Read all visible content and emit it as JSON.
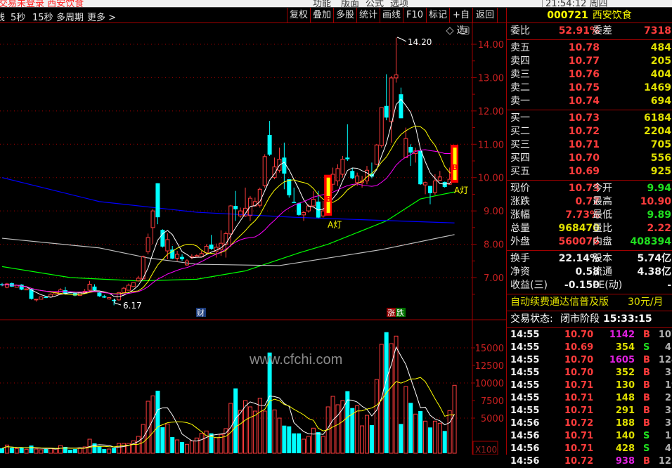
{
  "window": {
    "title": "交易未登录 西安饮食",
    "menu": [
      "功能",
      "版面",
      "公式",
      "选项"
    ],
    "clock": "21:54:12 周四"
  },
  "toolbar": {
    "left": [
      "线",
      "5秒",
      "15秒",
      "多周期",
      "更多 >"
    ],
    "buttons": [
      "复权",
      "叠加",
      "多股",
      "统计",
      "画线",
      "F10",
      "标记",
      "+自选",
      "返回"
    ]
  },
  "stock": {
    "code": "000721",
    "name": "西安饮食"
  },
  "order_ratio": {
    "label1": "委比",
    "value1": "52.91%",
    "label2": "委差",
    "value2": "7318"
  },
  "sell": [
    {
      "label": "卖五",
      "price": "10.78",
      "vol": "484"
    },
    {
      "label": "卖四",
      "price": "10.77",
      "vol": "205"
    },
    {
      "label": "卖三",
      "price": "10.76",
      "vol": "404"
    },
    {
      "label": "卖二",
      "price": "10.75",
      "vol": "1469"
    },
    {
      "label": "卖一",
      "price": "10.74",
      "vol": "694"
    }
  ],
  "buy": [
    {
      "label": "买一",
      "price": "10.73",
      "vol": "6184"
    },
    {
      "label": "买二",
      "price": "10.72",
      "vol": "2204"
    },
    {
      "label": "买三",
      "price": "10.71",
      "vol": "705"
    },
    {
      "label": "买四",
      "price": "10.70",
      "vol": "556"
    },
    {
      "label": "买五",
      "price": "10.69",
      "vol": "925"
    }
  ],
  "quote": [
    {
      "l1": "现价",
      "v1": "10.73",
      "c1": "red",
      "l2": "今开",
      "v2": "9.94",
      "c2": "grn"
    },
    {
      "l1": "涨跌",
      "v1": "0.77",
      "c1": "red",
      "l2": "最高",
      "v2": "10.90",
      "c2": "red"
    },
    {
      "l1": "涨幅",
      "v1": "7.73%",
      "c1": "red",
      "l2": "最低",
      "v2": "9.89",
      "c2": "grn"
    },
    {
      "l1": "总量",
      "v1": "968470",
      "c1": "yel",
      "l2": "量比",
      "v2": "2.22",
      "c2": "red"
    },
    {
      "l1": "外盘",
      "v1": "560076",
      "c1": "red",
      "l2": "内盘",
      "v2": "408394",
      "c2": "grn"
    }
  ],
  "finance": [
    {
      "l1": "换手",
      "v1": "22.14%",
      "l2": "股本",
      "v2": "5.74亿"
    },
    {
      "l1": "净资",
      "v1": "0.58",
      "l2": "流通",
      "v2": "4.38亿"
    },
    {
      "l1": "收益(三)",
      "v1": "-0.150",
      "l2": "PE(动)",
      "v2": "-"
    }
  ],
  "promo": {
    "text": "自动续费通达信普及版",
    "price": "30元/月"
  },
  "status": {
    "label": "交易状态:",
    "value": "闭市阶段",
    "time": "15:33:15"
  },
  "ticks": [
    {
      "t": "14:55",
      "p": "10.70",
      "v": "1142",
      "vc": "mag",
      "bs": "B",
      "n": "107"
    },
    {
      "t": "14:55",
      "p": "10.69",
      "v": "354",
      "vc": "yel",
      "bs": "S",
      "n": "41"
    },
    {
      "t": "14:55",
      "p": "10.70",
      "v": "1605",
      "vc": "mag",
      "bs": "B",
      "n": "124"
    },
    {
      "t": "14:55",
      "p": "10.70",
      "v": "352",
      "vc": "yel",
      "bs": "B",
      "n": "38"
    },
    {
      "t": "14:55",
      "p": "10.71",
      "v": "130",
      "vc": "yel",
      "bs": "B",
      "n": "19"
    },
    {
      "t": "14:55",
      "p": "10.71",
      "v": "148",
      "vc": "yel",
      "bs": "B",
      "n": "22"
    },
    {
      "t": "14:55",
      "p": "10.71",
      "v": "291",
      "vc": "yel",
      "bs": "B",
      "n": "33"
    },
    {
      "t": "14:56",
      "p": "10.72",
      "v": "188",
      "vc": "yel",
      "bs": "B",
      "n": "32"
    },
    {
      "t": "14:56",
      "p": "10.71",
      "v": "140",
      "vc": "yel",
      "bs": "S",
      "n": "15"
    },
    {
      "t": "14:56",
      "p": "10.71",
      "v": "428",
      "vc": "yel",
      "bs": "S",
      "n": "46"
    },
    {
      "t": "14:56",
      "p": "10.72",
      "v": "938",
      "vc": "mag",
      "bs": "B",
      "n": "123"
    }
  ],
  "colors": {
    "up": "#ff3c3c",
    "down": "#00ffff",
    "ma5": "#ffffff",
    "ma10": "#ffff00",
    "ma20": "#ff00ff",
    "ma60": "#00ff00",
    "ma120": "#c0c0c0",
    "ma250": "#0000ff",
    "grid": "#a00000",
    "signal": "#ff0000",
    "signal_inner": "#ffff00"
  },
  "chart_data": {
    "type": "candlestick",
    "price_axis": {
      "ticks": [
        "14.00",
        "13.00",
        "12.00",
        "11.00",
        "10.00",
        "9.00",
        "8.00",
        "7.00"
      ],
      "ylim": [
        6.17,
        14.2
      ]
    },
    "volume_axis": {
      "ticks": [
        "15000",
        "12500",
        "10000",
        "7500",
        "5000"
      ],
      "unit": "X100"
    },
    "annotations": {
      "high": "14.20",
      "low": "6.17",
      "signal_label": "A灯",
      "signal_letter": "B",
      "event_cai": "财",
      "event_zhang": "涨",
      "event_die": "跌"
    },
    "signal_indices": [
      67,
      93
    ],
    "ohlc": [
      [
        6.8,
        6.77,
        6.84,
        6.74
      ],
      [
        6.71,
        6.81,
        6.84,
        6.68
      ],
      [
        6.83,
        6.73,
        6.85,
        6.72
      ],
      [
        6.71,
        6.77,
        6.79,
        6.7
      ],
      [
        6.79,
        6.64,
        6.8,
        6.62
      ],
      [
        6.63,
        6.66,
        6.67,
        6.62
      ],
      [
        6.65,
        6.36,
        6.67,
        6.34
      ],
      [
        6.33,
        6.35,
        6.36,
        6.28
      ],
      [
        6.35,
        6.42,
        6.44,
        6.34
      ],
      [
        6.42,
        6.41,
        6.44,
        6.38
      ],
      [
        6.42,
        6.5,
        6.53,
        6.41
      ],
      [
        6.5,
        6.55,
        6.57,
        6.49
      ],
      [
        6.5,
        6.63,
        6.68,
        6.49
      ],
      [
        6.62,
        6.51,
        6.72,
        6.49
      ],
      [
        6.56,
        6.55,
        6.57,
        6.54
      ],
      [
        6.53,
        6.46,
        6.55,
        6.44
      ],
      [
        6.46,
        6.55,
        6.56,
        6.45
      ],
      [
        6.55,
        6.59,
        6.66,
        6.54
      ],
      [
        6.62,
        6.8,
        6.9,
        6.6
      ],
      [
        6.73,
        6.62,
        6.8,
        6.6
      ],
      [
        6.55,
        6.44,
        6.56,
        6.42
      ],
      [
        6.44,
        6.4,
        6.48,
        6.39
      ],
      [
        6.36,
        6.4,
        6.41,
        6.34
      ],
      [
        6.33,
        6.32,
        6.36,
        6.17
      ],
      [
        6.33,
        6.55,
        6.57,
        6.3
      ],
      [
        6.55,
        6.68,
        6.72,
        6.54
      ],
      [
        6.62,
        6.77,
        6.82,
        6.61
      ],
      [
        6.73,
        6.85,
        6.86,
        6.72
      ],
      [
        6.9,
        6.98,
        7.05,
        6.88
      ],
      [
        6.96,
        7.63,
        7.66,
        6.95
      ],
      [
        7.78,
        8.2,
        8.32,
        7.7
      ],
      [
        8.5,
        9.0,
        9.05,
        8.0
      ],
      [
        9.83,
        8.81,
        9.83,
        8.6
      ],
      [
        8.43,
        7.93,
        8.45,
        7.9
      ],
      [
        7.8,
        8.14,
        8.33,
        7.55
      ],
      [
        7.84,
        7.57,
        7.95,
        7.55
      ],
      [
        7.58,
        7.7,
        7.8,
        7.5
      ],
      [
        7.62,
        7.55,
        7.7,
        7.5
      ],
      [
        7.38,
        7.5,
        7.55,
        7.35
      ],
      [
        7.6,
        7.63,
        7.7,
        7.55
      ],
      [
        7.62,
        7.66,
        7.7,
        7.6
      ],
      [
        7.62,
        7.72,
        7.8,
        7.6
      ],
      [
        7.74,
        7.94,
        8.0,
        7.7
      ],
      [
        7.99,
        7.86,
        8.28,
        7.83
      ],
      [
        7.78,
        7.91,
        8.02,
        7.6
      ],
      [
        7.84,
        8.03,
        8.42,
        7.65
      ],
      [
        8.0,
        8.32,
        8.38,
        7.6
      ],
      [
        8.31,
        9.15,
        9.18,
        7.92
      ],
      [
        9.15,
        9.05,
        9.6,
        8.7
      ],
      [
        8.85,
        9.0,
        9.1,
        8.8
      ],
      [
        8.85,
        9.08,
        9.7,
        8.82
      ],
      [
        8.86,
        9.38,
        9.45,
        8.7
      ],
      [
        9.15,
        9.28,
        9.4,
        9.13
      ],
      [
        9.17,
        9.65,
        9.7,
        9.1
      ],
      [
        9.76,
        10.63,
        10.7,
        9.7
      ],
      [
        11.28,
        10.69,
        11.7,
        10.65
      ],
      [
        10.0,
        10.32,
        10.6,
        9.95
      ],
      [
        10.22,
        10.55,
        10.9,
        10.15
      ],
      [
        10.6,
        10.12,
        11.05,
        9.65
      ],
      [
        9.95,
        9.47,
        9.95,
        9.4
      ],
      [
        9.27,
        9.25,
        9.7,
        9.24
      ],
      [
        9.23,
        8.88,
        9.25,
        8.85
      ],
      [
        8.88,
        8.95,
        9.0,
        8.7
      ],
      [
        9.0,
        9.15,
        9.2,
        8.95
      ],
      [
        9.15,
        9.35,
        9.6,
        9.13
      ],
      [
        9.28,
        8.8,
        9.6,
        8.78
      ],
      [
        8.85,
        9.0,
        9.3,
        8.8
      ],
      [
        8.95,
        9.6,
        10.0,
        8.9
      ],
      [
        9.8,
        10.1,
        10.3,
        9.6
      ],
      [
        9.9,
        10.27,
        10.4,
        9.75
      ],
      [
        10.1,
        10.55,
        10.65,
        10.0
      ],
      [
        10.6,
        10.55,
        11.6,
        10.5
      ],
      [
        10.2,
        9.98,
        10.3,
        9.95
      ],
      [
        9.85,
        10.05,
        10.15,
        9.75
      ],
      [
        9.85,
        9.9,
        10.05,
        9.7
      ],
      [
        9.9,
        10.22,
        10.35,
        9.8
      ],
      [
        10.12,
        10.03,
        10.45,
        9.98
      ],
      [
        10.4,
        10.98,
        11.0,
        10.38
      ],
      [
        10.96,
        12.1,
        12.1,
        10.9
      ],
      [
        12.15,
        11.8,
        13.1,
        11.72
      ],
      [
        11.68,
        12.99,
        13.05,
        11.05
      ],
      [
        12.99,
        13.08,
        14.2,
        12.85
      ],
      [
        12.5,
        11.78,
        12.7,
        11.78
      ],
      [
        10.6,
        11.17,
        11.5,
        10.6
      ],
      [
        10.92,
        10.75,
        11.0,
        10.35
      ],
      [
        10.72,
        10.8,
        10.9,
        10.45
      ],
      [
        10.8,
        9.8,
        10.8,
        9.78
      ],
      [
        9.78,
        9.85,
        9.88,
        9.5
      ],
      [
        9.75,
        9.53,
        9.75,
        9.2
      ],
      [
        9.55,
        9.9,
        10.1,
        9.48
      ],
      [
        9.92,
        10.02,
        10.2,
        9.9
      ],
      [
        9.87,
        9.72,
        9.88,
        9.7
      ],
      [
        9.8,
        9.95,
        10.3,
        9.78
      ],
      [
        9.94,
        10.73,
        10.9,
        9.89
      ]
    ],
    "volume": [
      700,
      1170,
      770,
      670,
      770,
      570,
      1100,
      600,
      500,
      600,
      670,
      600,
      1100,
      900,
      500,
      600,
      770,
      900,
      2000,
      1400,
      1000,
      600,
      600,
      770,
      1400,
      1400,
      1400,
      1770,
      2400,
      4100,
      7400,
      8170,
      8900,
      3700,
      4170,
      2300,
      1900,
      1600,
      1270,
      1770,
      2170,
      2830,
      3170,
      2830,
      2230,
      2670,
      3500,
      7100,
      9230,
      6100,
      7500,
      6600,
      6000,
      7830,
      6000,
      14330,
      6170,
      5000,
      3930,
      3830,
      2830,
      2830,
      2000,
      2400,
      3570,
      3000,
      2400,
      6600,
      8100,
      6900,
      7500,
      8830,
      6430,
      6770,
      3900,
      5400,
      4000,
      10500,
      15500,
      17230,
      15600,
      16670,
      4170,
      9500,
      7170,
      5570,
      6000,
      4570,
      3670,
      4570,
      4270,
      3170,
      6070,
      9670
    ],
    "long_ma": {
      "ma60": [
        [
          0,
          7.33
        ],
        [
          14,
          7.0
        ],
        [
          28,
          6.9
        ],
        [
          40,
          6.95
        ],
        [
          50,
          7.2
        ],
        [
          61,
          7.74
        ],
        [
          67,
          8.0
        ],
        [
          79,
          8.7
        ],
        [
          86,
          9.36
        ],
        [
          93,
          9.57
        ]
      ],
      "ma120": [
        [
          0,
          8.18
        ],
        [
          20,
          7.89
        ],
        [
          30,
          7.59
        ],
        [
          40,
          7.4
        ],
        [
          57,
          7.36
        ],
        [
          72,
          7.7
        ],
        [
          78,
          7.84
        ],
        [
          93,
          8.29
        ]
      ],
      "ma250": [
        [
          0,
          10.0
        ],
        [
          20,
          9.28
        ],
        [
          40,
          8.96
        ],
        [
          60,
          8.81
        ],
        [
          79,
          8.71
        ],
        [
          93,
          8.64
        ]
      ]
    }
  },
  "watermark": "www.cfchi.com"
}
